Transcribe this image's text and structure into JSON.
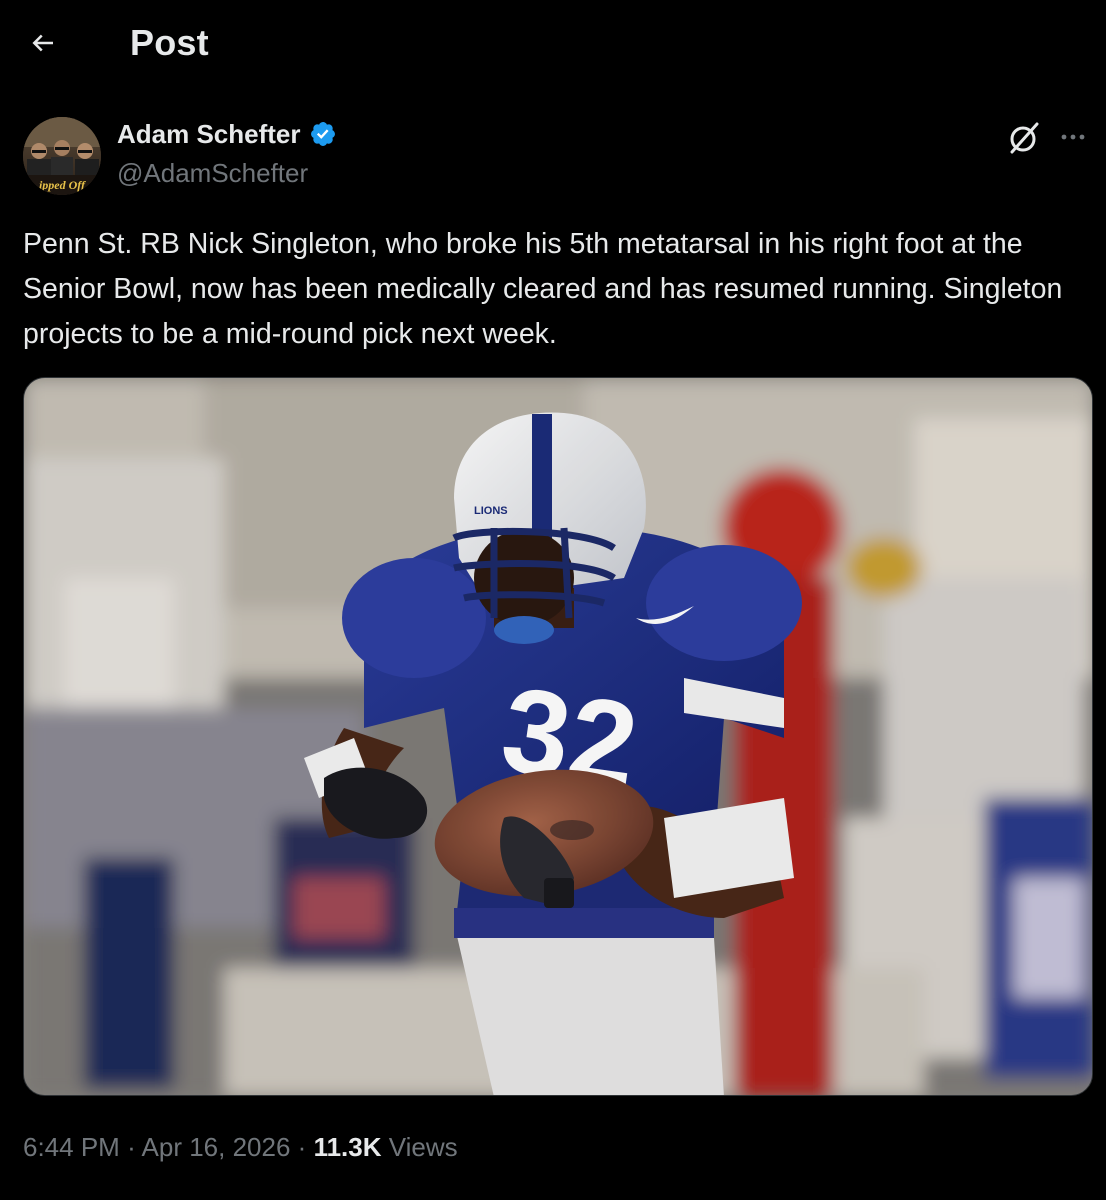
{
  "header": {
    "title": "Post",
    "back_icon": "arrow-left-icon"
  },
  "post": {
    "author": {
      "name": "Adam Schefter",
      "handle": "@AdamSchefter",
      "verified": true,
      "verified_icon": "verified-badge-icon",
      "avatar_text": "ipped Off"
    },
    "text": "Penn St. RB Nick Singleton, who broke his 5th metatarsal in his right foot at the Senior Bowl, now has been medically cleared and has resumed running. Singleton projects to be a mid-round pick next week.",
    "media": {
      "jersey_number": "32",
      "helmet_text": "LIONS"
    },
    "time": "6:44 PM",
    "date": "Apr 16, 2026",
    "separator": "·",
    "views_count": "11.3K",
    "views_label": "Views"
  },
  "actions": {
    "grok_icon": "grok-icon",
    "more_icon": "more-horizontal-icon"
  },
  "colors": {
    "background": "#000000",
    "text_primary": "#e7e9ea",
    "text_secondary": "#71767b",
    "verified_blue": "#1d9bf0",
    "border": "#2f3336"
  }
}
